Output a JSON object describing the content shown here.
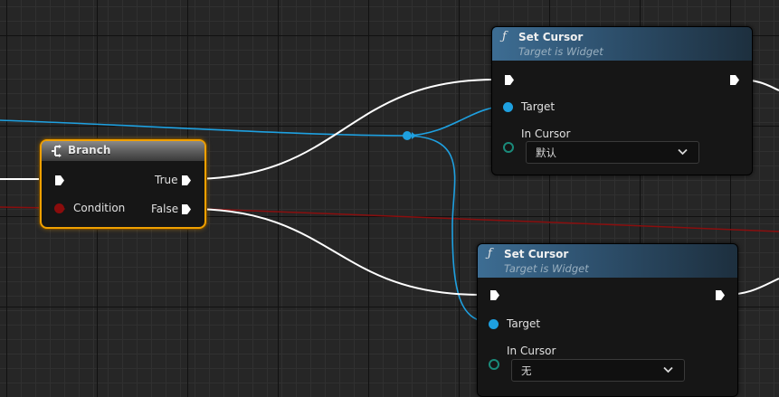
{
  "branch_node": {
    "title": "Branch",
    "true_label": "True",
    "condition_label": "Condition",
    "false_label": "False"
  },
  "set_cursor_top": {
    "title": "Set Cursor",
    "subtitle": "Target is Widget",
    "target_label": "Target",
    "in_cursor_label": "In Cursor",
    "in_cursor_value": "默认"
  },
  "set_cursor_bottom": {
    "title": "Set Cursor",
    "subtitle": "Target is Widget",
    "target_label": "Target",
    "in_cursor_label": "In Cursor",
    "in_cursor_value": "无"
  },
  "colors": {
    "exec_wire": "#ffffff",
    "object_wire": "#1ea0e0",
    "bool_wire": "#8a0e0e",
    "selection": "#f0a000",
    "function_header": "#3d6d93"
  },
  "icons": {
    "function": "f-italic",
    "branch": "branch-icon"
  }
}
